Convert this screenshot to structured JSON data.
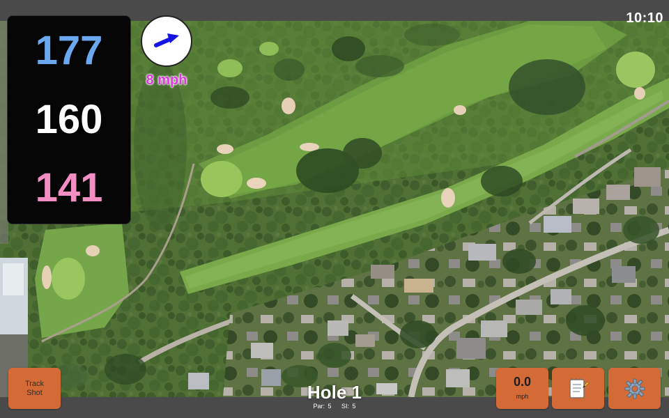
{
  "status": {
    "time": "10:10"
  },
  "distances": {
    "back": "177",
    "middle": "160",
    "front": "141",
    "colors": {
      "back": "#6aa8f0",
      "middle": "#ffffff",
      "front": "#f38ec5"
    }
  },
  "wind": {
    "speed_label": "8 mph",
    "icon": "wind-direction-arrow-icon",
    "arrow_color": "#1414e6"
  },
  "hole": {
    "title": "Hole 1",
    "par": "Par: 5",
    "si": "SI: 5"
  },
  "buttons": {
    "track_shot": [
      "Track",
      "Shot"
    ],
    "wind_value": "0.0",
    "wind_unit": "mph",
    "notes_icon": "notepad-icon",
    "settings_icon": "gear-icon",
    "button_color": "#d46b37"
  },
  "map": {
    "description_icon": "satellite-map-image"
  }
}
